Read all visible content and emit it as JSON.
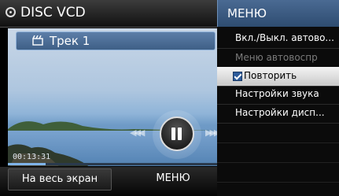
{
  "header": {
    "title": "DISC VCD",
    "icon": "disc-icon"
  },
  "player": {
    "track_label": "Трек  1",
    "time": "00:13:31",
    "progress": 0.18,
    "controls": {
      "rewind_icon": "rewind-icon",
      "pause_icon": "pause-icon",
      "forward_icon": "fast-forward-icon"
    }
  },
  "bottom": {
    "fullscreen_label": "На весь экран",
    "menu_label": "МЕНЮ"
  },
  "menu": {
    "title": "МЕНЮ",
    "items": [
      {
        "label": "Вкл./Выкл. автово...",
        "state": "enabled"
      },
      {
        "label": "Меню автовоспр",
        "state": "disabled"
      },
      {
        "label": "Повторить",
        "state": "selected-checked"
      },
      {
        "label": "Настройки звука",
        "state": "enabled"
      },
      {
        "label": "Настройки дисп...",
        "state": "enabled"
      }
    ]
  },
  "colors": {
    "menu_header": "#3b5a80",
    "selected_bg": "#e8e8e8",
    "accent": "#7fb3e8"
  }
}
